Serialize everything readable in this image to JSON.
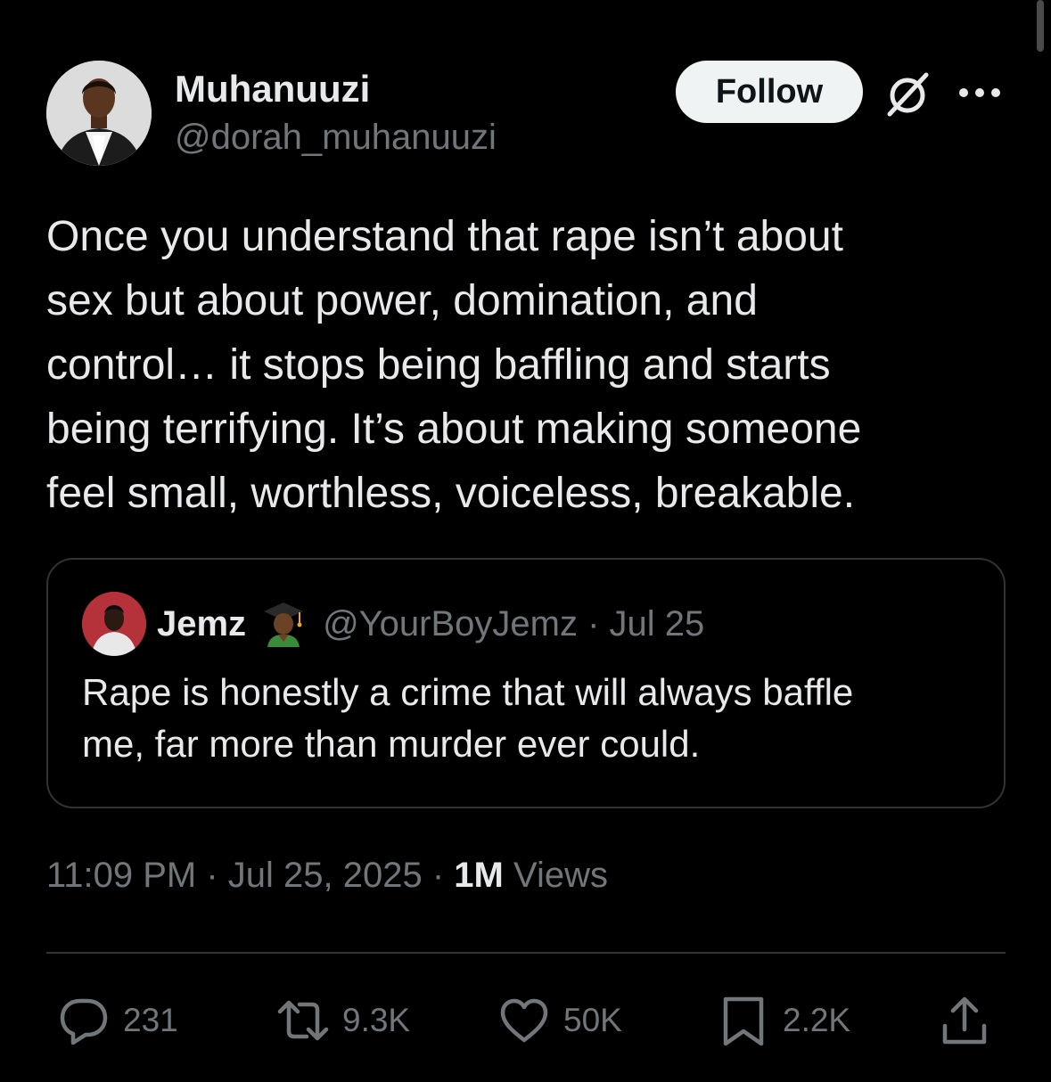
{
  "author": {
    "display_name": "Muhanuuzi",
    "handle": "@dorah_muhanuuzi",
    "avatar": "avatar"
  },
  "header": {
    "follow_label": "Follow",
    "grok_icon": "grok-icon",
    "more_icon": "more-icon"
  },
  "tweet": {
    "text": "Once you understand that rape isn’t about\nsex but about power, domination, and\ncontrol… it stops being baffling and starts\nbeing terrifying. It’s about making someone\nfeel small, worthless, voiceless, breakable."
  },
  "quoted": {
    "display_name": "Jemz",
    "emoji": "graduate-emoji",
    "handle_date": "@YourBoyJemz · Jul 25",
    "text": "Rape is honestly a crime that will always baffle\nme, far more than murder ever could."
  },
  "meta": {
    "time_date": "11:09 PM · Jul 25, 2025 · ",
    "views_count": "1M",
    "views_label": " Views"
  },
  "actions": {
    "replies": "231",
    "reposts": "9.3K",
    "likes": "50K",
    "bookmarks": "2.2K"
  }
}
